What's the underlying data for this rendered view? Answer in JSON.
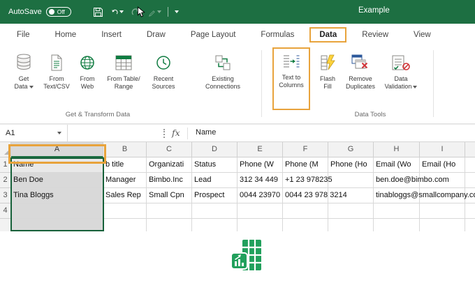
{
  "colors": {
    "titlebar_green": "#1d6f42",
    "annotation_orange": "#E8A33C",
    "selection_green": "#17613a",
    "logo_green": "#21a05c"
  },
  "titlebar": {
    "autosave_label": "AutoSave",
    "autosave_state": "Off",
    "title": "Example"
  },
  "icons": {
    "save-icon": "floppy-disk",
    "undo-icon": "arrow-counterclockwise",
    "redo-icon": "arrow-clockwise",
    "brush-icon": "pen",
    "chevron-down-icon": "triangle-down",
    "mouse-cursor-icon": "pointer-arrow",
    "database-icon": "cylinder",
    "text-file-icon": "document-lines",
    "globe-icon": "globe",
    "table-icon": "table-grid",
    "clock-icon": "clock",
    "connections-icon": "linked-boxes",
    "text-to-columns-icon": "lines-split-arrow",
    "flash-fill-icon": "lightning-bolt",
    "remove-duplicates-icon": "sheets-red-x",
    "data-validation-icon": "checklist-check-ban",
    "grip-dots-icon": "vertical-dots",
    "select-all-corner": "gray-triangle",
    "excel-logo": "green-sheet-with-chart"
  },
  "tabs": {
    "items": [
      {
        "label": "File"
      },
      {
        "label": "Home"
      },
      {
        "label": "Insert"
      },
      {
        "label": "Draw"
      },
      {
        "label": "Page Layout"
      },
      {
        "label": "Formulas"
      },
      {
        "label": "Data",
        "active": true
      },
      {
        "label": "Review"
      },
      {
        "label": "View"
      }
    ]
  },
  "ribbon": {
    "buttons": [
      {
        "lines": [
          "Get",
          "Data"
        ],
        "dropdown": true
      },
      {
        "lines": [
          "From",
          "Text/CSV"
        ]
      },
      {
        "lines": [
          "From",
          "Web"
        ]
      },
      {
        "lines": [
          "From Table/",
          "Range"
        ]
      },
      {
        "lines": [
          "Recent",
          "Sources"
        ]
      },
      {
        "lines": [
          "Existing",
          "Connections"
        ]
      },
      {
        "lines": [
          "Text to",
          "Columns"
        ],
        "highlighted": true
      },
      {
        "lines": [
          "Flash",
          "Fill"
        ]
      },
      {
        "lines": [
          "Remove",
          "Duplicates"
        ]
      },
      {
        "lines": [
          "Data",
          "Validation"
        ],
        "dropdown": true
      }
    ],
    "groups": [
      {
        "label": "Get & Transform Data"
      },
      {
        "label": "Data Tools"
      }
    ]
  },
  "formula_bar": {
    "name_box": "A1",
    "fx_label": "fx",
    "content": "Name"
  },
  "grid": {
    "column_headers": [
      "A",
      "B",
      "C",
      "D",
      "E",
      "F",
      "G",
      "H",
      "I"
    ],
    "row_headers": [
      "1",
      "2",
      "3",
      "4"
    ],
    "selection": "Column A",
    "rows": [
      {
        "cells": [
          "Name",
          "b title",
          "Organizati",
          "Status",
          "Phone (W",
          "Phone (M",
          "Phone (Ho",
          "Email (Wo",
          "Email (Ho"
        ]
      },
      {
        "cells": [
          "Ben Doe",
          "Manager",
          "Bimbo.Inc",
          "Lead",
          "312 34 449",
          "+1 23 978235",
          "",
          "ben.doe@bimbo.com",
          ""
        ]
      },
      {
        "cells": [
          "Tina Bloggs",
          "Sales Rep",
          "Small Cpn",
          "Prospect",
          "0044 23970",
          "0044 23 978 3214",
          "",
          "tinabloggs@smallcompany.com",
          ""
        ]
      },
      {
        "cells": [
          "",
          "",
          "",
          "",
          "",
          "",
          "",
          "",
          ""
        ]
      }
    ]
  }
}
